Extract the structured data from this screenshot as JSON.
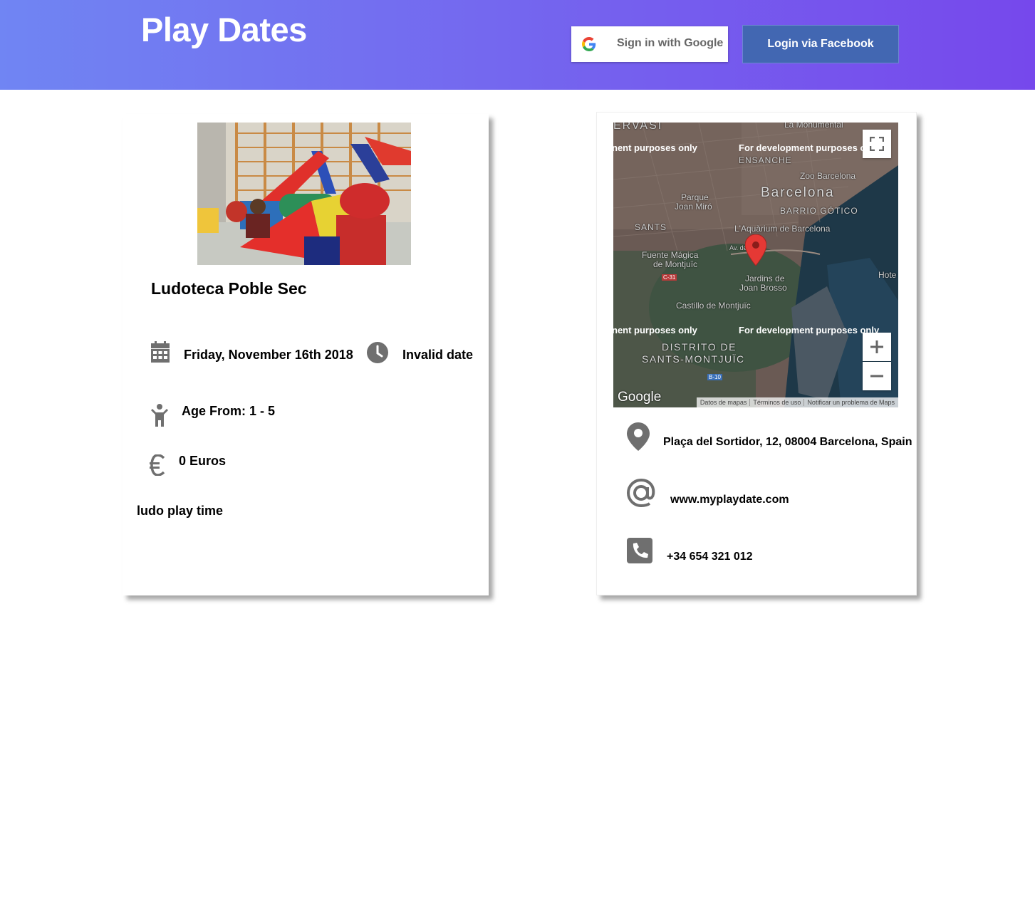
{
  "header": {
    "brand": "Play Dates",
    "google_label": "Sign in with Google",
    "facebook_label": "Login via Facebook"
  },
  "event": {
    "title": "Ludoteca Poble Sec",
    "date": "Friday, November 16th 2018",
    "time": "Invalid date",
    "age": "Age From: 1 - 5",
    "price": "0 Euros",
    "description": "ludo play time"
  },
  "map": {
    "dev_notice": "For development purposes only",
    "dev_notice_cut": "nent purposes only",
    "labels": {
      "gervasi": "ERVASI",
      "monumental": "La Monumental",
      "ensanche": "ENSANCHE",
      "zoo": "Zoo Barcelona",
      "barcelona": "Barcelona",
      "gotico": "BARRIO GÓTICO",
      "parque": "Parque",
      "joan_miro": "Joan Miró",
      "sants": "SANTS",
      "aquarium": "L'Aquàrium de Barcelona",
      "fuente": "Fuente Mágica",
      "montjuic_short": "de Montjuïc",
      "jardins": "Jardins de",
      "joan_brosso": "Joan Brosso",
      "castillo": "Castillo de Montjuïc",
      "hotel": "Hote",
      "districto": "DISTRITO DE",
      "sants_montjuic": "SANTS-MONTJUÏC",
      "c31": "C-31",
      "b10": "B-10",
      "av": "Av. de"
    },
    "google_mark": "Google",
    "attribution": [
      "Datos de mapas",
      "Términos de uso",
      "Notificar un problema de Maps"
    ]
  },
  "contact": {
    "address": "Plaça del Sortidor, 12, 08004 Barcelona, Spain",
    "website": "www.myplaydate.com",
    "phone": "+34 654 321 012"
  },
  "colors": {
    "header_start": "#7085f3",
    "header_end": "#7648ec",
    "facebook": "#4267b2",
    "icon_gray": "#6f6f6f",
    "marker_red": "#e53935"
  }
}
